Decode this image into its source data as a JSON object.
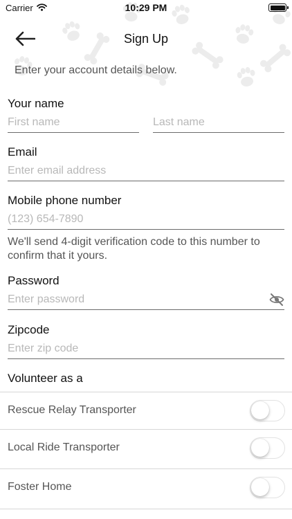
{
  "status_bar": {
    "carrier": "Carrier",
    "time": "10:29 PM"
  },
  "nav": {
    "title": "Sign Up",
    "back_icon": "arrow-left-icon"
  },
  "subtitle": "Enter your account details below.",
  "form": {
    "name": {
      "label": "Your name",
      "first_placeholder": "First name",
      "last_placeholder": "Last name"
    },
    "email": {
      "label": "Email",
      "placeholder": "Enter email address"
    },
    "phone": {
      "label": "Mobile phone number",
      "placeholder": "(123) 654-7890",
      "helper": "We'll send 4-digit verification code to this number to confirm that it yours."
    },
    "password": {
      "label": "Password",
      "placeholder": "Enter password",
      "toggle_icon": "eye-slash-icon"
    },
    "zipcode": {
      "label": "Zipcode",
      "placeholder": "Enter zip code"
    },
    "volunteer": {
      "label": "Volunteer as a",
      "options": [
        {
          "label": "Rescue Relay Transporter",
          "enabled": false
        },
        {
          "label": "Local Ride Transporter",
          "enabled": false
        },
        {
          "label": "Foster Home",
          "enabled": false
        }
      ]
    }
  },
  "colors": {
    "background_pattern": "#eeeeee",
    "placeholder": "#b8b8b8",
    "divider": "#d6d6d6"
  }
}
